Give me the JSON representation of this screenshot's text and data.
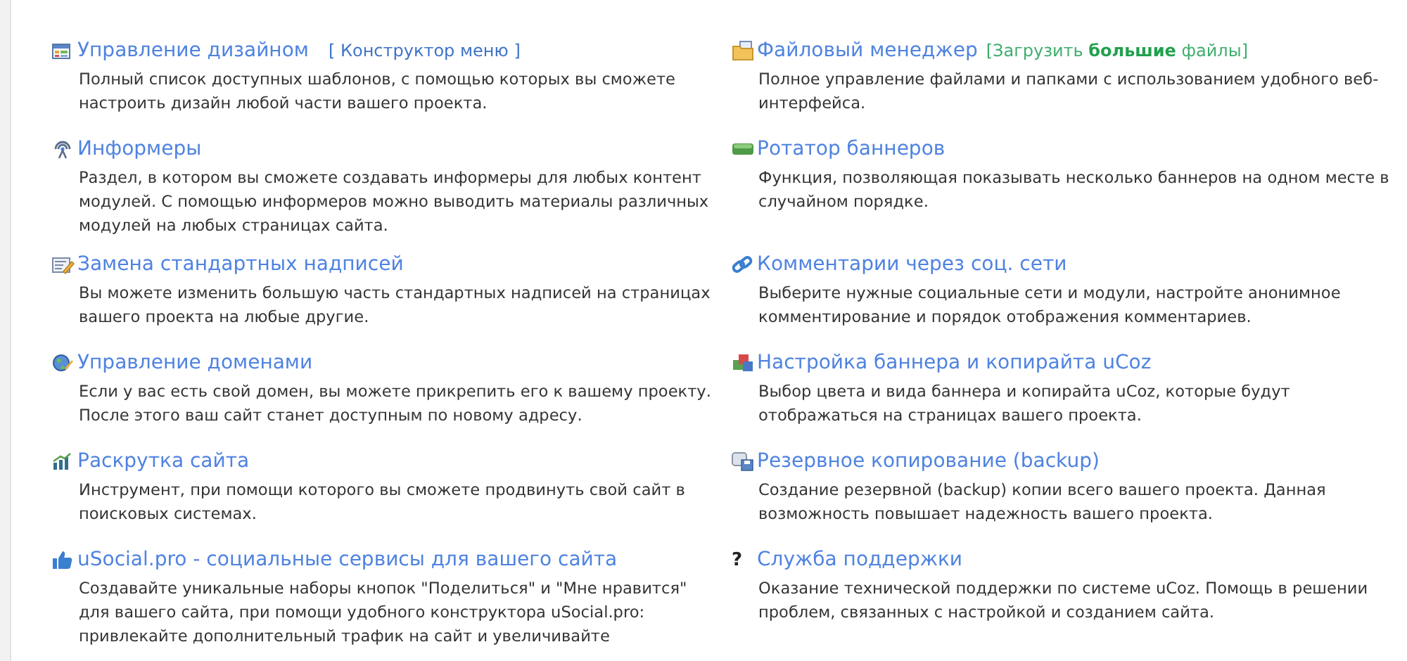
{
  "items": [
    {
      "title": "Управление дизайном",
      "extra": {
        "kind": "link",
        "text": "[ Конструктор меню ]"
      },
      "description": "Полный список доступных шаблонов, с помощью которых вы сможете настроить дизайн любой части вашего проекта."
    },
    {
      "title": "Файловый менеджер",
      "extra": {
        "kind": "upload",
        "text": "[Загрузить **большие** файлы]"
      },
      "description": "Полное управление файлами и папками с использованием удобного веб-интерфейса."
    },
    {
      "title": "Информеры",
      "description": "Раздел, в котором вы сможете создавать информеры для любых контент модулей. С помощью информеров можно выводить материалы различных модулей на любых страницах сайта."
    },
    {
      "title": "Ротатор баннеров",
      "description": "Функция, позволяющая показывать несколько баннеров на одном месте в случайном порядке."
    },
    {
      "title": "Замена стандартных надписей",
      "description": "Вы можете изменить большую часть стандартных надписей на страницах вашего проекта на любые другие."
    },
    {
      "title": "Комментарии через соц. сети",
      "description": "Выберите нужные социальные сети и модули, настройте анонимное комментирование и порядок отображения комментариев."
    },
    {
      "title": "Управление доменами",
      "description": "Если у вас есть свой домен, вы можете прикрепить его к вашему проекту. После этого ваш сайт станет доступным по новому адресу."
    },
    {
      "title": "Настройка баннера и копирайта uCoz",
      "description": "Выбор цвета и вида баннера и копирайта uCoz, которые будут отображаться на страницах вашего проекта."
    },
    {
      "title": "Раскрутка сайта",
      "description": "Инструмент, при помощи которого вы сможете продвинуть свой сайт в поисковых системах."
    },
    {
      "title": "Резервное копирование (backup)",
      "description": "Создание резервной (backup) копии всего вашего проекта. Данная возможность повышает надежность вашего проекта."
    },
    {
      "title": "uSocial.pro - социальные сервисы для вашего сайта",
      "description": "Создавайте уникальные наборы кнопок \"Поделиться\" и \"Мне нравится\" для вашего сайта, при помощи удобного конструктора uSocial.pro: привлекайте дополнительный трафик на сайт и увеличивайте"
    },
    {
      "glyph": "?",
      "title": "Служба поддержки",
      "description": "Оказание технической поддержки по системе uCoz. Помощь в решении проблем, связанных с настройкой и созданием сайта."
    }
  ]
}
